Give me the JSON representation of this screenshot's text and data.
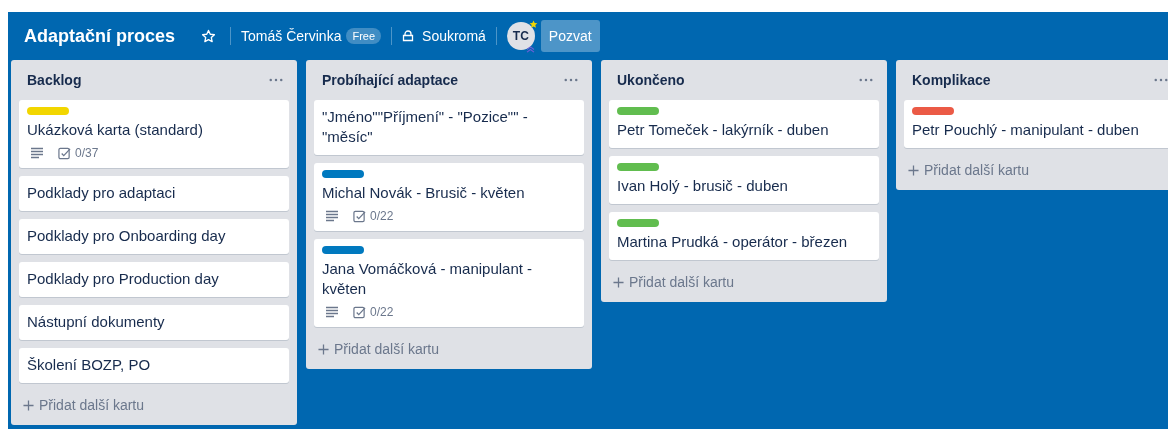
{
  "board": {
    "title": "Adaptační proces",
    "starred": false,
    "owner": "Tomáš Červinka",
    "plan": "Free",
    "visibility": "Soukromá",
    "avatar": "TC",
    "invite": "Pozvat"
  },
  "lists": [
    {
      "title": "Backlog",
      "cards": [
        {
          "color": "#f2d600",
          "title": "Ukázková karta (standard)",
          "description": true,
          "checklist": "0/37"
        },
        {
          "title": "Podklady pro adaptaci"
        },
        {
          "title": "Podklady pro Onboarding day"
        },
        {
          "title": "Podklady pro Production day"
        },
        {
          "title": "Nástupní dokumenty"
        },
        {
          "title": "Školení BOZP, PO"
        }
      ],
      "add": "Přidat další kartu"
    },
    {
      "title": "Probíhající adaptace",
      "cards": [
        {
          "title": "\"Jméno\"\"Příjmení\" - \"Pozice\"\" - \"měsíc\""
        },
        {
          "color": "#0079bf",
          "title": "Michal Novák - Brusič - květen",
          "description": true,
          "checklist": "0/22"
        },
        {
          "color": "#0079bf",
          "title": "Jana Vomáčková - manipulant - květen",
          "description": true,
          "checklist": "0/22"
        }
      ],
      "add": "Přidat další kartu"
    },
    {
      "title": "Ukončeno",
      "cards": [
        {
          "color": "#61bd4f",
          "title": "Petr Tomeček - lakýrník - duben"
        },
        {
          "color": "#61bd4f",
          "title": "Ivan Holý - brusič - duben"
        },
        {
          "color": "#61bd4f",
          "title": "Martina Prudká - operátor - březen"
        }
      ],
      "add": "Přidat další kartu"
    },
    {
      "title": "Komplikace",
      "cards": [
        {
          "color": "#eb5a46",
          "title": "Petr Pouchlý - manipulant - duben"
        }
      ],
      "add": "Přidat další kartu"
    }
  ]
}
